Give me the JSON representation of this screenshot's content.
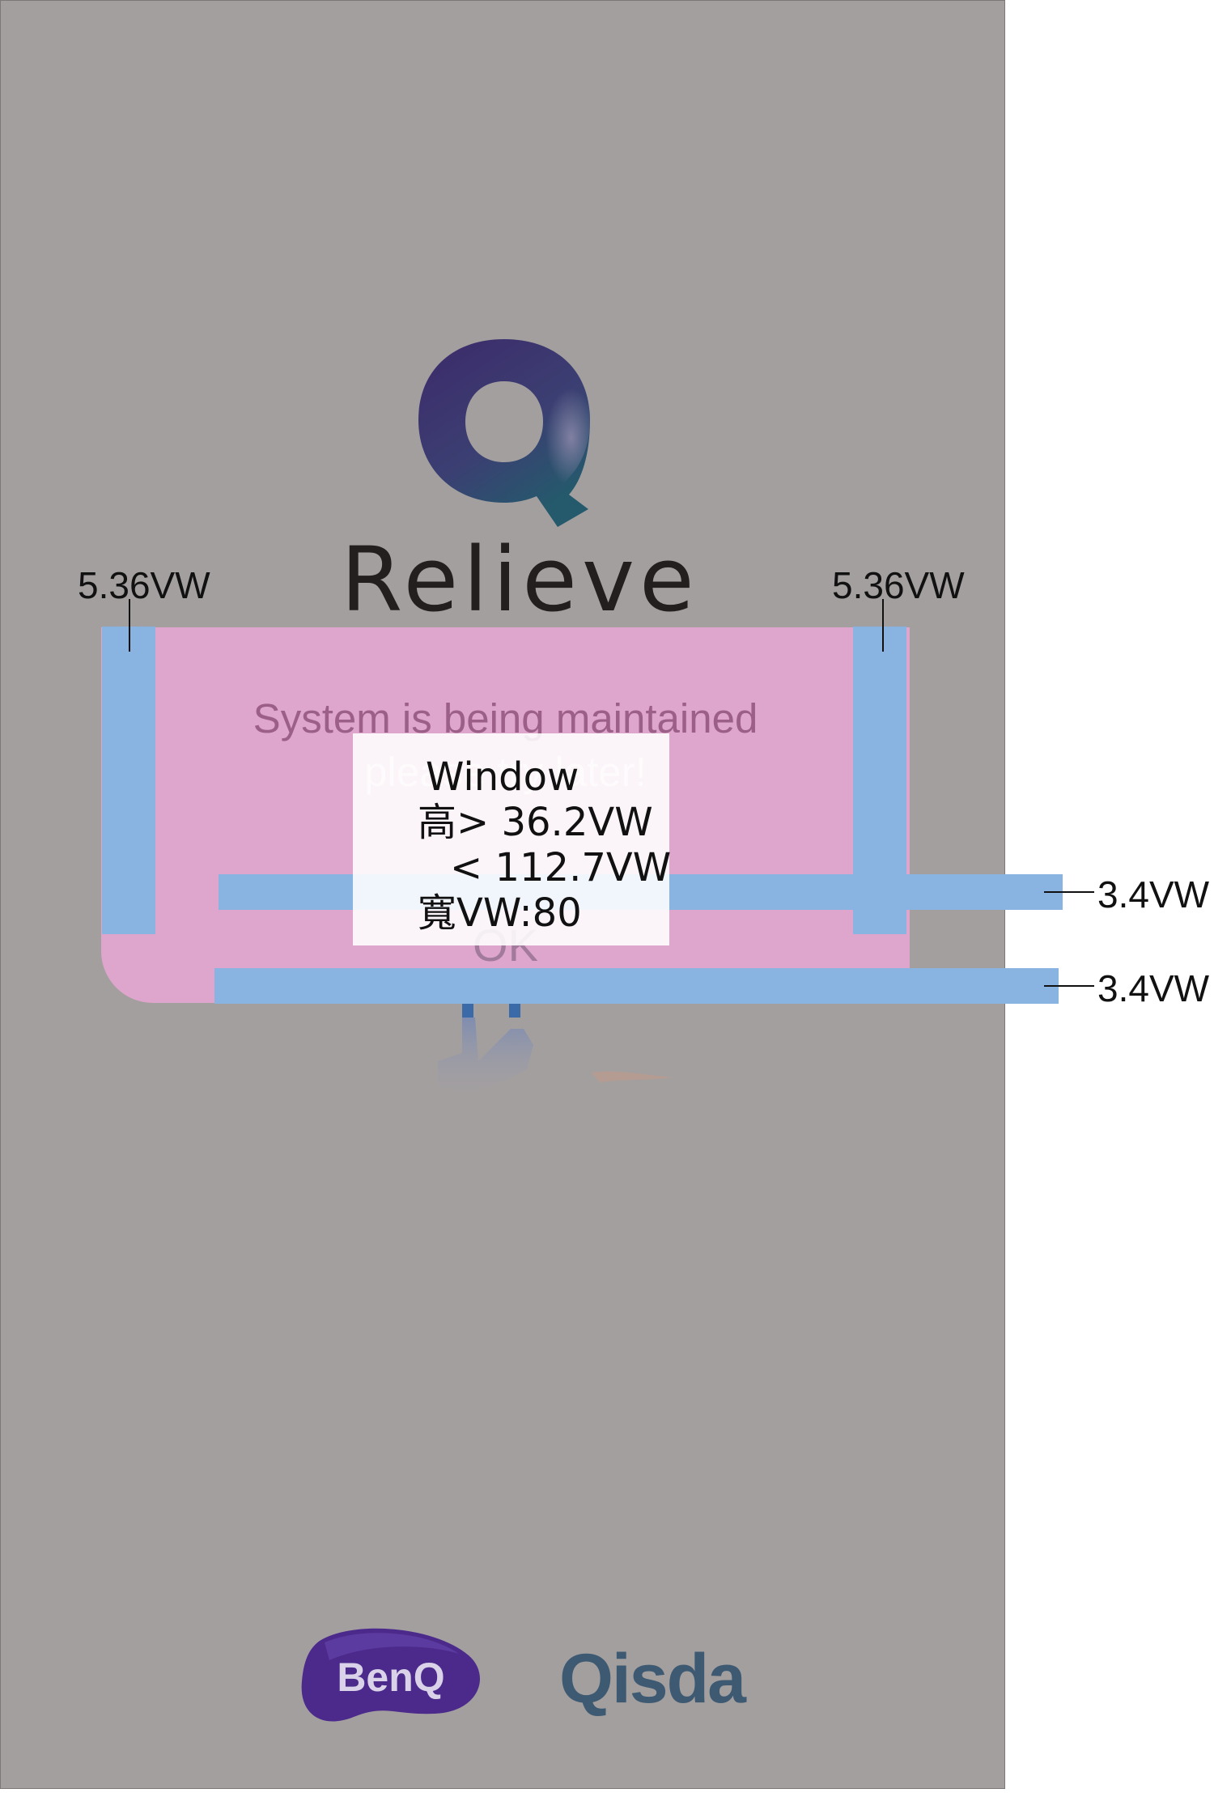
{
  "app": {
    "brand_name": "Relieve",
    "logo_letter": "Q"
  },
  "dialog": {
    "message_line1": "System is being maintained",
    "message_line2": "please try later!",
    "ok_label": "OK"
  },
  "annotations": {
    "left_width": "5.36VW",
    "right_width": "5.36VW",
    "bar1_height": "3.4VW",
    "bar2_height": "3.4VW",
    "window_title": "Window",
    "window_height_min": "高> 36.2VW",
    "window_height_max": "< 112.7VW",
    "window_width": "寬VW:80"
  },
  "footer": {
    "logo1_text": "BenQ",
    "logo2_text": "Qisda"
  },
  "colors": {
    "screen_bg": "#a39f9f",
    "dialog_bg": "#dea6cc",
    "guide_bar": "#89b4e2",
    "benq_purple": "#4b2a8c",
    "qisda_blue": "#3e5a72"
  }
}
